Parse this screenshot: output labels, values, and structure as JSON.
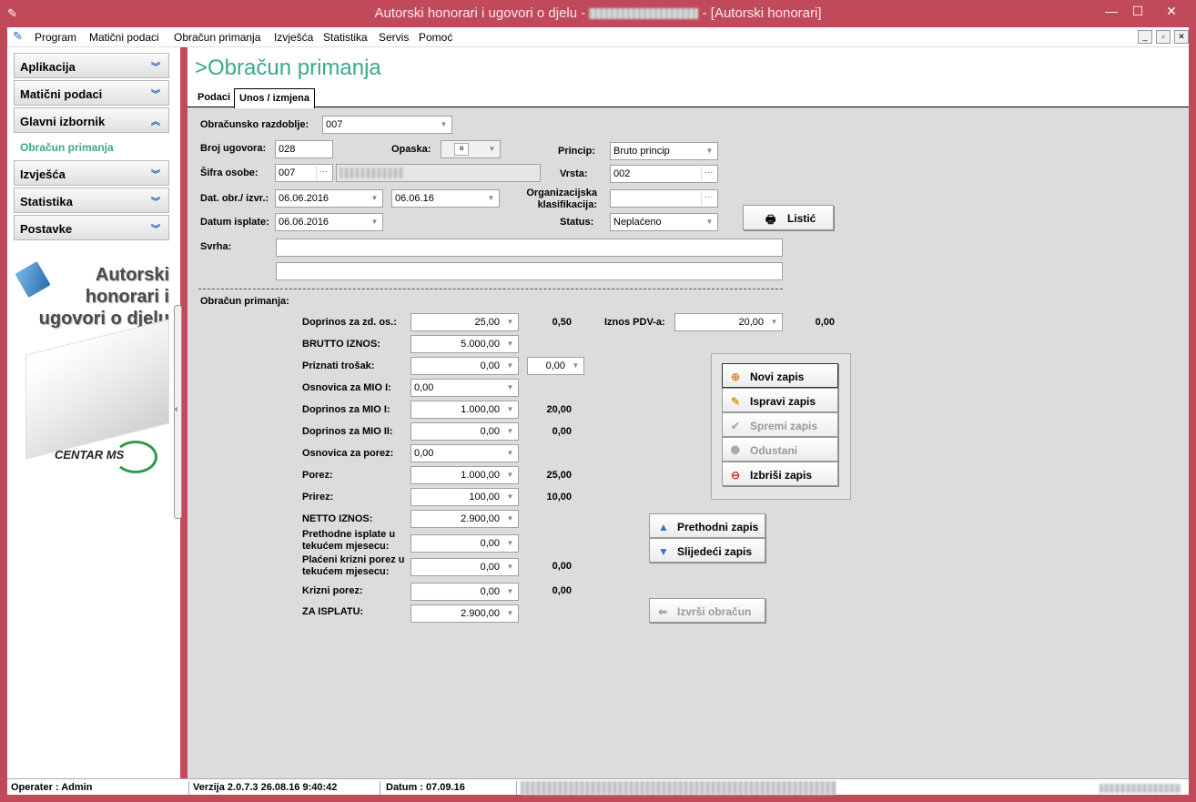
{
  "window": {
    "title": "Autorski honorari i ugovori o djelu -",
    "title_suffix": "- [Autorski honorari]",
    "minimize": "—",
    "maximize": "☐",
    "close": "✕"
  },
  "menu": [
    "Program",
    "Matični podaci",
    "Obračun primanja",
    "Izvješća",
    "Statistika",
    "Servis",
    "Pomoć"
  ],
  "sidebar": {
    "items": [
      {
        "label": "Aplikacija",
        "chevron": "»"
      },
      {
        "label": "Matični podaci",
        "chevron": "»"
      },
      {
        "label": "Glavni izbornik",
        "chevron": "«"
      },
      {
        "label": "Izvješća",
        "chevron": "»"
      },
      {
        "label": "Statistika",
        "chevron": "»"
      },
      {
        "label": "Postavke",
        "chevron": "»"
      }
    ],
    "sub_item": "Obračun primanja",
    "logo_text": [
      "Autorski",
      "honorari i",
      "ugovori o djelu"
    ],
    "company_logo": "CENTAR MS"
  },
  "page": {
    "title": ">Obračun primanja",
    "tabs": [
      "Podaci",
      "Unos / izmjena"
    ],
    "active_tab": 1
  },
  "form": {
    "razdoblje_label": "Obračunsko razdoblje:",
    "razdoblje": "007",
    "broj_label": "Broj ugovora:",
    "broj": "028",
    "opaska_label": "Opaska:",
    "princip_label": "Princip:",
    "princip": "Bruto princip",
    "sifra_label": "Šifra osobe:",
    "sifra": "007",
    "vrsta_label": "Vrsta:",
    "vrsta": "002",
    "dat_label": "Dat. obr./ izvr.:",
    "dat1": "06.06.2016",
    "dat2": "06.06.16",
    "org_label1": "Organizacijska",
    "org_label2": "klasifikacija:",
    "isplata_label": "Datum isplate:",
    "isplata": "06.06.2016",
    "status_label": "Status:",
    "status": "Neplaćeno",
    "svrha_label": "Svrha:",
    "listic": "Listić"
  },
  "calc": {
    "section_label": "Obračun primanja:",
    "rows": [
      {
        "label": "Doprinos za zd. os.:",
        "value": "25,00",
        "extra": "0,50"
      },
      {
        "label": "BRUTTO IZNOS:",
        "value": "5.000,00",
        "extra": ""
      },
      {
        "label": "Priznati trošak:",
        "value": "0,00",
        "extra": ""
      },
      {
        "label": "Osnovica za MIO I:",
        "value": "0,00",
        "extra": ""
      },
      {
        "label": "Doprinos za MIO I:",
        "value": "1.000,00",
        "extra": "20,00"
      },
      {
        "label": "Doprinos za MIO II:",
        "value": "0,00",
        "extra": "0,00"
      },
      {
        "label": "Osnovica za porez:",
        "value": "0,00",
        "extra": ""
      },
      {
        "label": "Porez:",
        "value": "1.000,00",
        "extra": "25,00"
      },
      {
        "label": "Prirez:",
        "value": "100,00",
        "extra": "10,00"
      },
      {
        "label": "NETTO IZNOS:",
        "value": "2.900,00",
        "extra": ""
      },
      {
        "label": "Prethodne isplate u tekućem mjesecu:",
        "value": "0,00",
        "extra": ""
      },
      {
        "label": "Plaćeni krizni porez u tekućem mjesecu:",
        "value": "0,00",
        "extra": "0,00"
      },
      {
        "label": "Krizni porez:",
        "value": "0,00",
        "extra": "0,00"
      },
      {
        "label": "ZA ISPLATU:",
        "value": "2.900,00",
        "extra": ""
      }
    ],
    "trosak_pct": "0,00",
    "pdv_label": "Iznos PDV-a:",
    "pdv": "20,00",
    "pdv_extra": "0,00"
  },
  "actions": {
    "new": "Novi zapis",
    "edit": "Ispravi zapis",
    "save": "Spremi zapis",
    "cancel": "Odustani",
    "delete": "Izbriši zapis",
    "prev": "Prethodni zapis",
    "next": "Slijedeći zapis",
    "execute": "Izvrši obračun"
  },
  "status": {
    "operater": "Operater :  Admin",
    "verzija": "Verzija 2.0.7.3    26.08.16 9:40:42",
    "datum": "Datum  :  07.09.16"
  }
}
